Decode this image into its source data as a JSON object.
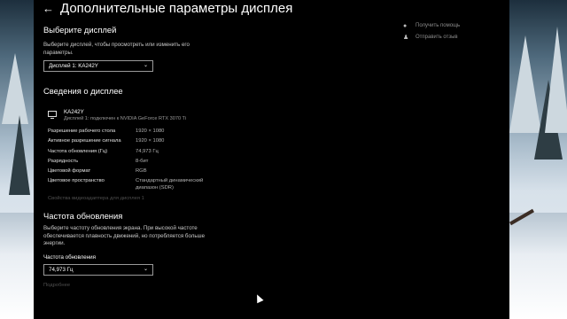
{
  "window": {
    "title": "Дополнительные параметры дисплея"
  },
  "select_display": {
    "heading": "Выберите дисплей",
    "description": "Выберите дисплей, чтобы просмотреть или изменить его параметры.",
    "dropdown_value": "Дисплей 1: KA242Y"
  },
  "display_info": {
    "heading": "Сведения о дисплее",
    "device_name": "KA242Y",
    "device_sub": "Дисплей 1: подключен к NVIDIA GeForce RTX 3070 Ti",
    "rows": [
      {
        "label": "Разрешение рабочего стола",
        "value": "1920 × 1080"
      },
      {
        "label": "Активное разрешение сигнала",
        "value": "1920 × 1080"
      },
      {
        "label": "Частота обновления (Гц)",
        "value": "74,973 Гц"
      },
      {
        "label": "Разрядность",
        "value": "8-бит"
      },
      {
        "label": "Цветовой формат",
        "value": "RGB"
      },
      {
        "label": "Цветовое пространство",
        "value": "Стандартный динамический диапазон (SDR)"
      }
    ],
    "adapter_link": "Свойства видеоадаптера для дисплея 1"
  },
  "refresh_rate": {
    "heading": "Частота обновления",
    "description": "Выберите частоту обновления экрана. При высокой частоте обеспечивается плавность движений, но потребляется больше энергии.",
    "label": "Частота обновления",
    "dropdown_value": "74,973 Гц",
    "more_link": "Подробнее"
  },
  "help": {
    "get_help": "Получить помощь",
    "feedback": "Отправить отзыв"
  }
}
